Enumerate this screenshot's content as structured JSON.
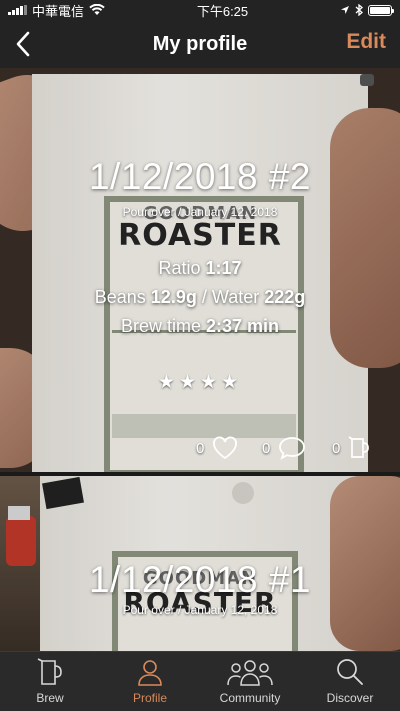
{
  "status_bar": {
    "carrier": "中華電信",
    "time": "下午6:25",
    "battery_level": 1.0
  },
  "nav": {
    "title": "My profile",
    "edit_label": "Edit",
    "back_icon": "chevron-left-icon"
  },
  "posts": [
    {
      "title": "1/12/2018 #2",
      "subtitle": "Pour over / January 12, 2018",
      "ratio_label": "Ratio",
      "ratio_value": "1:17",
      "beans_label": "Beans",
      "beans_value": "12.9g",
      "separator": "/",
      "water_label": "Water",
      "water_value": "222g",
      "time_label": "Brew time",
      "time_value": "2:37 min",
      "stars": "★★★★",
      "rating": 4,
      "likes": "0",
      "comments": "0",
      "brews": "0",
      "photo": {
        "brand": "GOODMAN",
        "product": "ROASTER"
      }
    },
    {
      "title": "1/12/2018 #1",
      "subtitle": "Pour over / January 12, 2018",
      "photo": {
        "brand": "GOODMAN",
        "product": "ROASTER"
      }
    }
  ],
  "tabs": [
    {
      "label": "Brew",
      "icon": "pitcher-icon",
      "active": false
    },
    {
      "label": "Profile",
      "icon": "person-icon",
      "active": true
    },
    {
      "label": "Community",
      "icon": "people-icon",
      "active": false
    },
    {
      "label": "Discover",
      "icon": "search-icon",
      "active": false
    }
  ],
  "colors": {
    "accent": "#d9895a",
    "bar_background": "#232323",
    "tab_background": "#2a2a2a"
  }
}
